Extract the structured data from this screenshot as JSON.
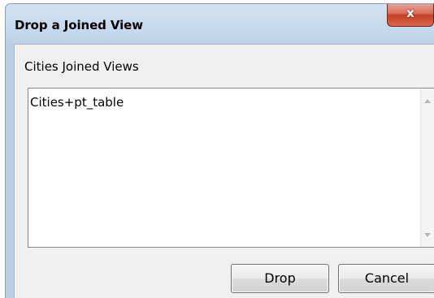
{
  "dialog": {
    "title": "Drop a Joined View",
    "close_label": "x"
  },
  "content": {
    "group_label": "Cities Joined Views",
    "list_items": [
      "Cities+pt_table"
    ]
  },
  "buttons": {
    "drop_label": "Drop",
    "cancel_label": "Cancel"
  }
}
